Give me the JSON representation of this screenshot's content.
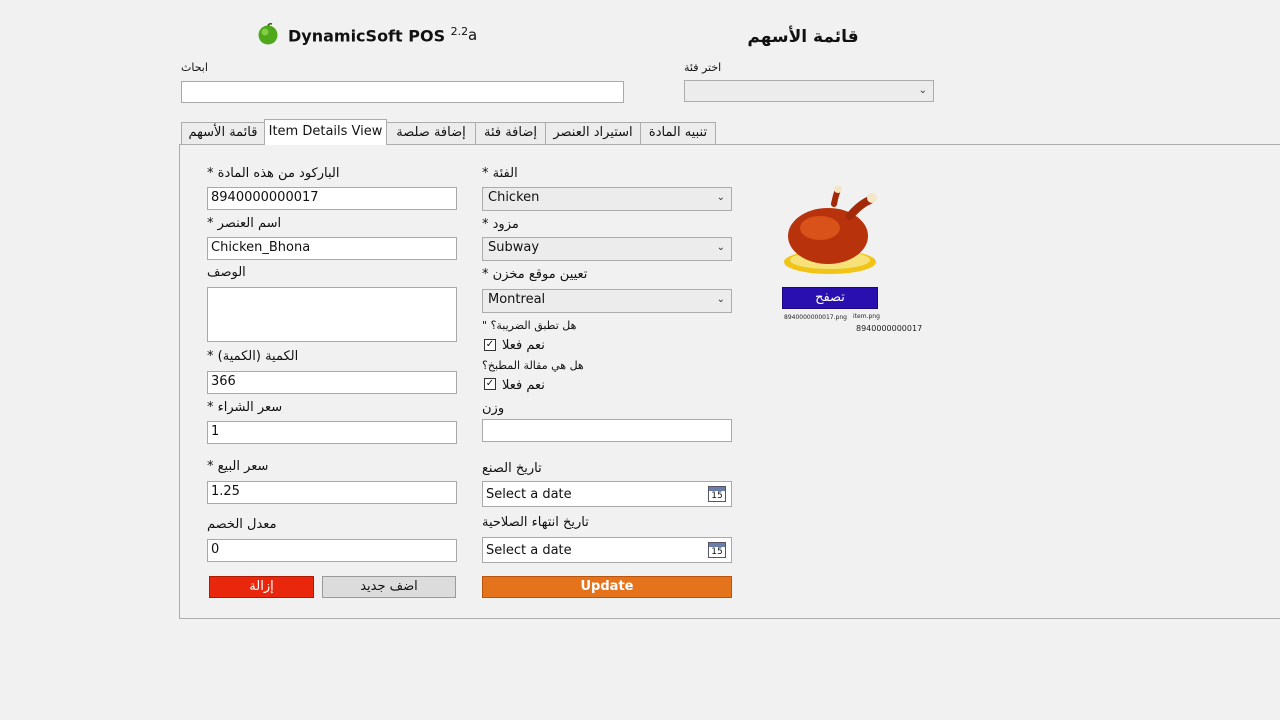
{
  "app": {
    "brand": "DynamicSoft POS",
    "version": "2.2",
    "extra_label": "a",
    "page_title": "قائمة الأسهم"
  },
  "top": {
    "search_label": "ابحاث",
    "search_value": "",
    "category_label": "اختر فئة",
    "category_value": ""
  },
  "tabs": [
    {
      "label": "قائمة الأسهم"
    },
    {
      "label": "Item Details View"
    },
    {
      "label": "إضافة صلصة"
    },
    {
      "label": "إضافة فئة"
    },
    {
      "label": "استيراد العنصر"
    },
    {
      "label": "تنبيه المادة"
    }
  ],
  "form": {
    "barcode_label": "* الباركود من هذه المادة",
    "barcode_value": "8940000000017",
    "name_label": "* اسم العنصر",
    "name_value": "Chicken_Bhona",
    "desc_label": "الوصف",
    "desc_value": "",
    "qty_label": "* (الكمية (الكمية",
    "qty_value": "366",
    "buy_label": "* سعر الشراء",
    "buy_value": "1",
    "sell_label": "* سعر البيع",
    "sell_value": "1.25",
    "discount_label": "معدل الخصم",
    "discount_value": "0",
    "category_label": "* الفئة",
    "category_value": "Chicken",
    "supplier_label": "* مزود",
    "supplier_value": "Subway",
    "location_label": "* تعيين موقع مخزن",
    "location_value": "Montreal",
    "tax_question": "\" هل تطبق الضريبة؟",
    "tax_check_label": "نعم فعلا",
    "tax_checked": true,
    "kitchen_question": "هل هي مقالة المطبخ؟",
    "kitchen_check_label": "نعم فعلا",
    "kitchen_checked": true,
    "weight_label": "وزن",
    "weight_value": "",
    "mfg_label": "تاريخ الصنع",
    "mfg_placeholder": "Select a date",
    "exp_label": "تاريخ انتهاء الصلاحية",
    "exp_placeholder": "Select a date",
    "calendar_day": "15"
  },
  "buttons": {
    "delete": "إزالة",
    "add_new": "اضف جديد",
    "update": "Update",
    "browse": "تصفح"
  },
  "image": {
    "filename_left": "8940000000017.png",
    "filename_right": "item.png",
    "code": "8940000000017"
  },
  "colors": {
    "delete_bg": "#e8270d",
    "update_bg": "#e5731c",
    "browse_bg": "#2a0fb0"
  }
}
